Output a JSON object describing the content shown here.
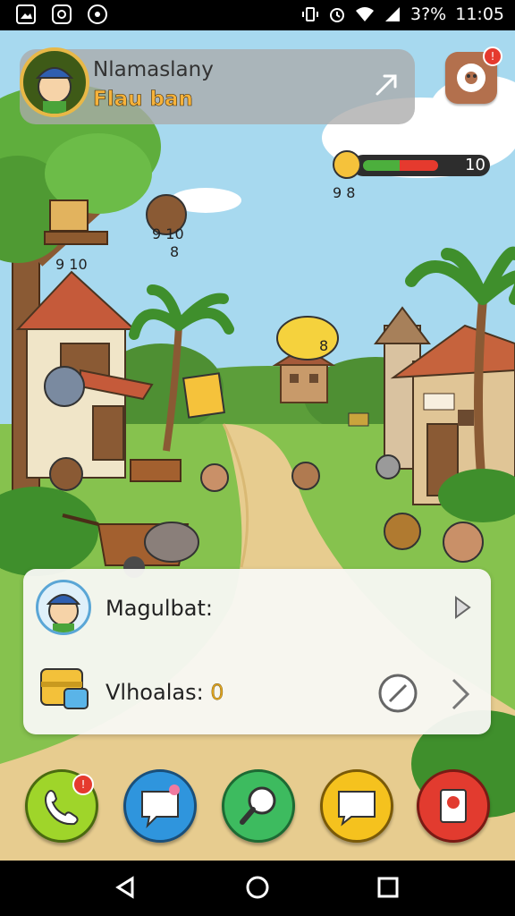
{
  "status_bar": {
    "battery": "3?%",
    "time": "11:05"
  },
  "hud": {
    "player_name": "Nlamaslany",
    "player_subtitle": "Flau ban",
    "notification_badge": "!",
    "energy_value": "10",
    "energy_level": 0.62,
    "energy_caption": "9 8"
  },
  "scene_labels": {
    "bear_label": "9 10",
    "bear_label_sub": "8",
    "treehouse_label": "9 10",
    "bubble_label": "8"
  },
  "panel": {
    "player_name": "Magulbat:",
    "item_label": "Vlhoalas:",
    "item_count": "0"
  },
  "dock": {
    "phone_badge": "!"
  },
  "colors": {
    "sky": "#9fd3ea",
    "grass": "#7fbf4a",
    "path": "#e6c98a",
    "dock_green": "#9fd52a",
    "dock_blue": "#2f95dd",
    "dock_teal": "#3dbb5f",
    "dock_yellow": "#f5c21e",
    "dock_red": "#e23b2f"
  },
  "icons": [
    "whatsapp-icon",
    "instagram-icon",
    "pinterest-icon",
    "wifi-icon",
    "signal-icon",
    "settings-gear-icon",
    "phone-icon",
    "chat-bubble-icon",
    "magnifier-icon",
    "message-icon",
    "flag-icon",
    "back-icon",
    "home-icon",
    "recents-icon"
  ]
}
